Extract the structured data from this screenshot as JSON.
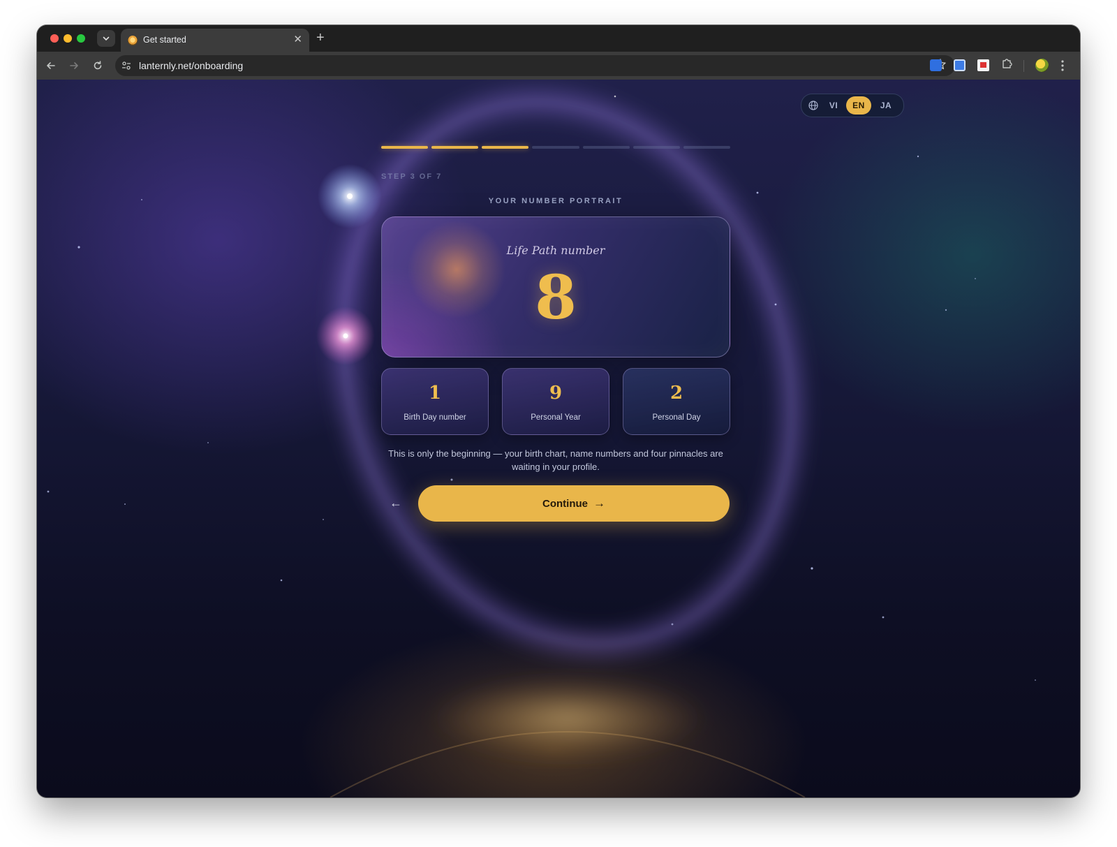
{
  "browser": {
    "tab_title": "Get started",
    "tab_close": "✕",
    "new_tab": "+",
    "url": "lanternly.net/onboarding"
  },
  "lang_switcher": {
    "options": [
      "VI",
      "EN",
      "JA"
    ],
    "selected": "EN"
  },
  "progress": {
    "total_steps": 7,
    "completed_steps": 3,
    "step_label": "STEP 3 OF 7"
  },
  "portrait": {
    "section_label": "YOUR NUMBER PORTRAIT",
    "life_path_label": "Life Path number",
    "life_path_value": "8",
    "cards": [
      {
        "value": "1",
        "label": "Birth Day number"
      },
      {
        "value": "9",
        "label": "Personal Year"
      },
      {
        "value": "2",
        "label": "Personal Day"
      }
    ]
  },
  "blurb": "This is only the beginning — your birth chart, name numbers and four pinnacles are waiting in your profile.",
  "actions": {
    "back_glyph": "←",
    "continue_label": "Continue",
    "continue_arrow": "→"
  },
  "colors": {
    "accent": "#e9b64a",
    "number_gold": "#efbd4e"
  }
}
